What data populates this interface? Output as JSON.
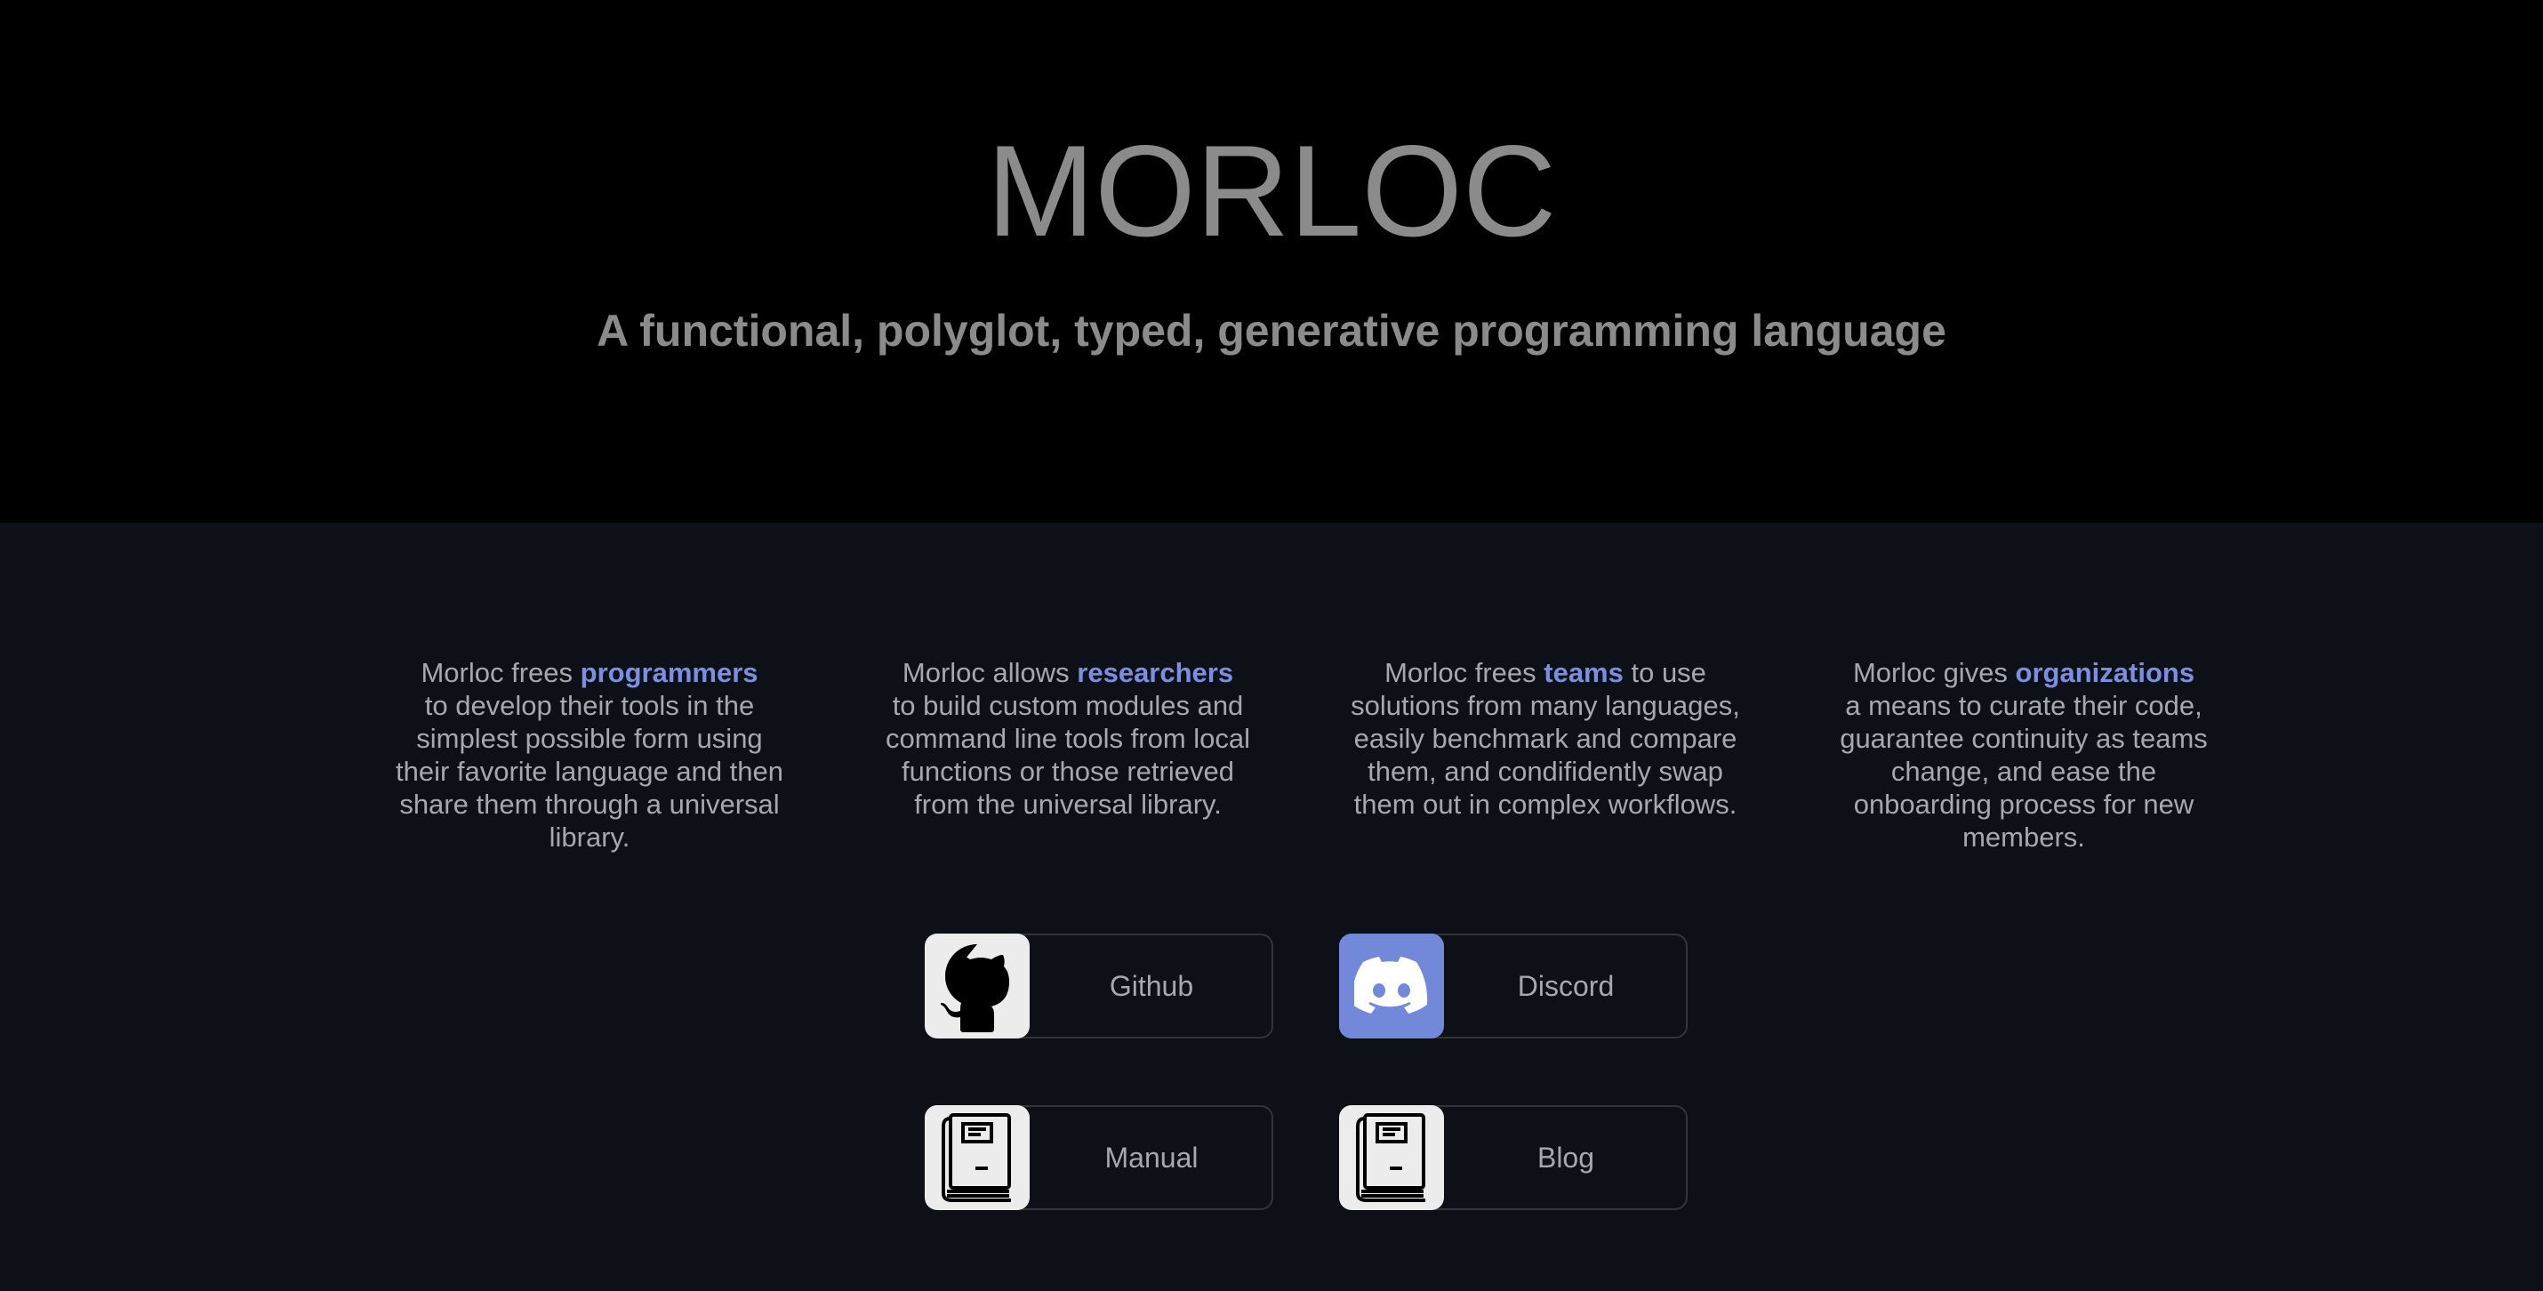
{
  "hero": {
    "title": "MORLOC",
    "subtitle": "A functional, polyglot, typed, generative programming language"
  },
  "features": [
    {
      "prefix": "Morloc frees ",
      "keyword": "programmers",
      "text": " to develop their tools in the simplest possible form using their favorite language and then share them through a universal library."
    },
    {
      "prefix": "Morloc allows ",
      "keyword": "researchers",
      "text": " to build custom modules and command line tools from local functions or those retrieved from the universal library."
    },
    {
      "prefix": "Morloc frees ",
      "keyword": "teams",
      "text": " to use solutions from many languages, easily benchmark and compare them, and condifidently swap them out in complex workflows."
    },
    {
      "prefix": "Morloc gives ",
      "keyword": "organizations",
      "text": " a means to curate their code, guarantee continuity as teams change, and ease the onboarding process for new members."
    }
  ],
  "links": {
    "github": {
      "label": "Github",
      "icon": "github-icon"
    },
    "discord": {
      "label": "Discord",
      "icon": "discord-icon"
    },
    "manual": {
      "label": "Manual",
      "icon": "book-icon"
    },
    "blog": {
      "label": "Blog",
      "icon": "book-icon"
    }
  },
  "colors": {
    "hero_bg": "#000000",
    "page_bg": "#0d1117",
    "accent": "#7b8fe0",
    "text": "#a5a8ad",
    "discord_bg": "#7289da"
  }
}
